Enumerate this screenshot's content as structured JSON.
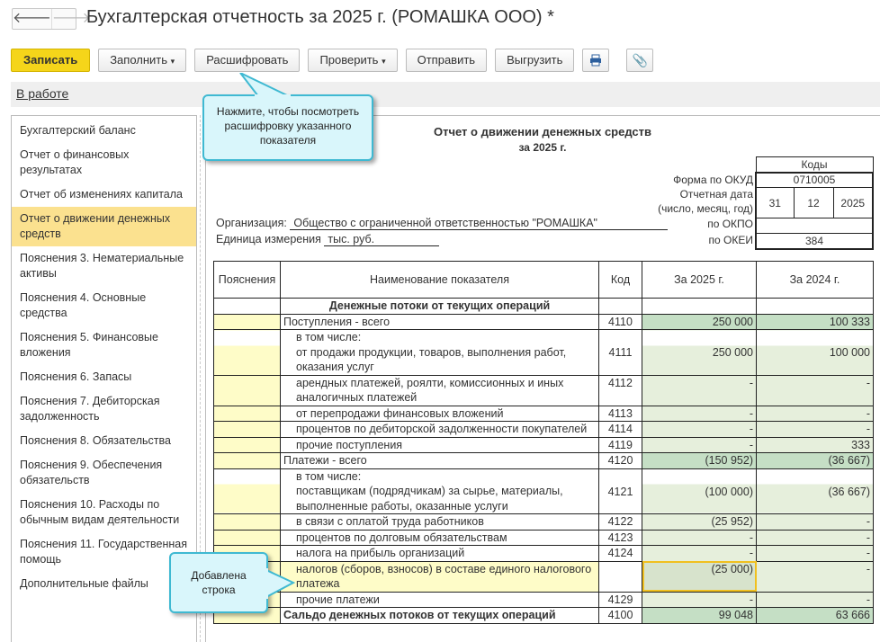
{
  "window": {
    "title": "Бухгалтерская отчетность за 2025 г. (РОМАШКА ООО) *",
    "back": "🡐",
    "forward": "🡒"
  },
  "toolbar": {
    "save": "Записать",
    "fill": "Заполнить",
    "decode": "Расшифровать",
    "check": "Проверить",
    "send": "Отправить",
    "export": "Выгрузить",
    "print_icon": "printer-icon",
    "attach_icon": "paperclip-icon"
  },
  "status": {
    "label": "В работе"
  },
  "sidebar": {
    "items": [
      "Бухгалтерский баланс",
      "Отчет о финансовых результатах",
      "Отчет об изменениях капитала",
      "Отчет о движении денежных средств",
      "Пояснения 3. Нематериальные активы",
      "Пояснения 4. Основные средства",
      "Пояснения 5. Финансовые вложения",
      "Пояснения 6. Запасы",
      "Пояснения 7. Дебиторская задолженность",
      "Пояснения 8. Обязательства",
      "Пояснения 9. Обеспечения обязательств",
      "Пояснения 10. Расходы по обычным видам деятельности",
      "Пояснения 11. Государственная помощь",
      "Дополнительные файлы"
    ],
    "active_index": 3
  },
  "report": {
    "title": "Отчет о движении денежных средств",
    "period": "за 2025 г.",
    "codes_header": "Коды",
    "okud_label": "Форма по ОКУД",
    "okud": "0710005",
    "date_label": "Отчетная дата",
    "date_sub": "(число, месяц, год)",
    "day": "31",
    "month": "12",
    "year": "2025",
    "okpo_label": "по ОКПО",
    "okpo": "",
    "okei_label": "по ОКЕИ",
    "okei": "384",
    "org_label": "Организация:",
    "org": "Общество с ограниченной ответственностью \"РОМАШКА\"",
    "unit_label": "Единица измерения",
    "unit": "тыс. руб."
  },
  "table": {
    "headers": [
      "Пояснения",
      "Наименование показателя",
      "Код",
      "За 2025 г.",
      "За 2024 г."
    ],
    "rows": [
      {
        "type": "section",
        "name": "Денежные потоки от текущих операций",
        "code": "",
        "v2025": "",
        "v2024": ""
      },
      {
        "type": "total",
        "name": "Поступления - всего",
        "code": "4110",
        "v2025": "250 000",
        "v2024": "100 333"
      },
      {
        "type": "sub",
        "lead": "в том числе:",
        "name": "от продажи продукции, товаров, выполнения работ, оказания услуг",
        "code": "4111",
        "v2025": "250 000",
        "v2024": "100 000"
      },
      {
        "type": "item",
        "name": "арендных платежей, роялти, комиссионных и иных аналогичных платежей",
        "code": "4112",
        "v2025": "-",
        "v2024": "-"
      },
      {
        "type": "item",
        "name": "от перепродажи финансовых вложений",
        "code": "4113",
        "v2025": "-",
        "v2024": "-"
      },
      {
        "type": "item",
        "name": "процентов по дебиторской задолженности покупателей",
        "code": "4114",
        "v2025": "-",
        "v2024": "-"
      },
      {
        "type": "item",
        "name": "прочие поступления",
        "code": "4119",
        "v2025": "-",
        "v2024": "333"
      },
      {
        "type": "total",
        "name": "Платежи - всего",
        "code": "4120",
        "v2025": "(150 952)",
        "v2024": "(36 667)"
      },
      {
        "type": "sub",
        "lead": "в том числе:",
        "name": "поставщикам (подрядчикам) за сырье, материалы, выполненные работы, оказанные услуги",
        "code": "4121",
        "v2025": "(100 000)",
        "v2024": "(36 667)"
      },
      {
        "type": "item",
        "name": "в связи с оплатой труда работников",
        "code": "4122",
        "v2025": "(25 952)",
        "v2024": "-"
      },
      {
        "type": "item",
        "name": "процентов по долговым обязательствам",
        "code": "4123",
        "v2025": "-",
        "v2024": "-"
      },
      {
        "type": "item",
        "name": "налога на прибыль организаций",
        "code": "4124",
        "v2025": "-",
        "v2024": "-"
      },
      {
        "type": "added",
        "name": "налогов (сборов, взносов) в составе единого налогового платежа",
        "code": "",
        "v2025": "(25 000)",
        "v2024": "-"
      },
      {
        "type": "item",
        "name": "прочие платежи",
        "code": "4129",
        "v2025": "-",
        "v2024": "-"
      },
      {
        "type": "final",
        "name": "Сальдо денежных потоков от текущих операций",
        "code": "4100",
        "v2025": "99 048",
        "v2024": "63 666"
      }
    ]
  },
  "callouts": {
    "decode_hint": "Нажмите, чтобы посмотреть расшифровку указанного показателя",
    "added_row": "Добавлена строка"
  },
  "colors": {
    "save_button": "#f5d51a",
    "active_item": "#fbe18f",
    "explanation_cell": "#fefcc8",
    "total_cell": "#c5dfc5",
    "value_cell": "#e6efdc",
    "callout_border": "#3fb9d2",
    "highlight": "#f0c020"
  }
}
